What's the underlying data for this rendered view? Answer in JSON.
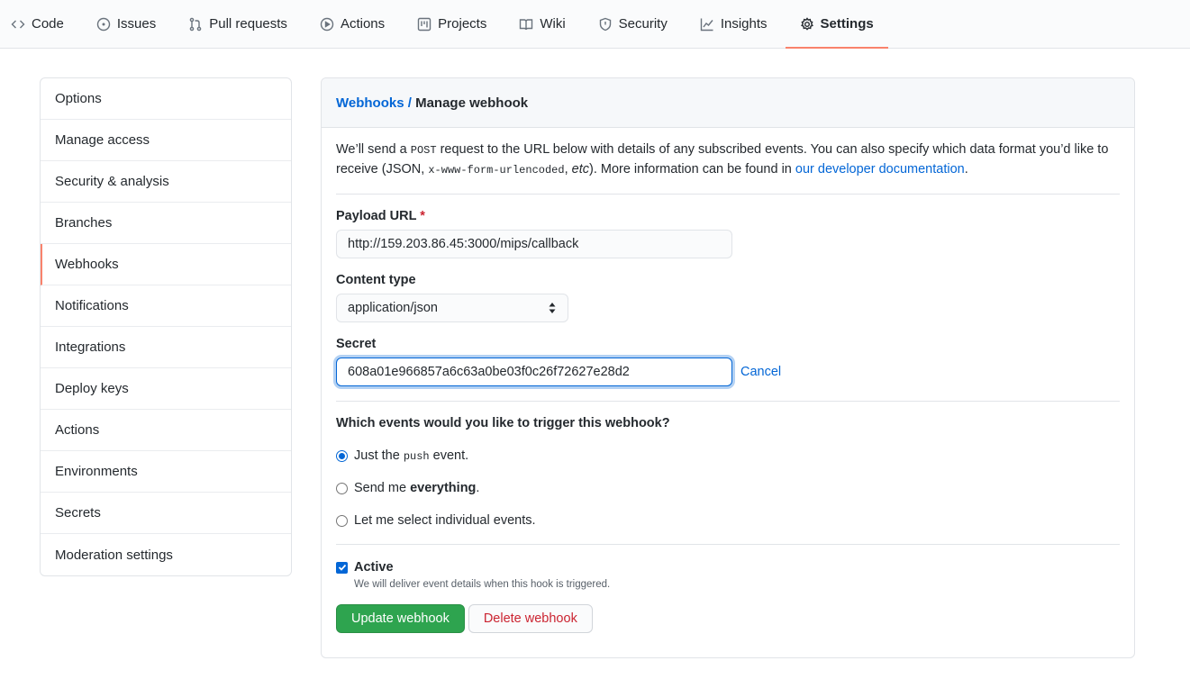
{
  "nav": {
    "tabs": [
      {
        "label": "Code",
        "icon": "code-icon"
      },
      {
        "label": "Issues",
        "icon": "issue-icon"
      },
      {
        "label": "Pull requests",
        "icon": "pull-request-icon"
      },
      {
        "label": "Actions",
        "icon": "play-icon"
      },
      {
        "label": "Projects",
        "icon": "project-icon"
      },
      {
        "label": "Wiki",
        "icon": "book-icon"
      },
      {
        "label": "Security",
        "icon": "shield-icon"
      },
      {
        "label": "Insights",
        "icon": "graph-icon"
      },
      {
        "label": "Settings",
        "icon": "gear-icon",
        "selected": true
      }
    ]
  },
  "sidebar": {
    "items": [
      {
        "label": "Options"
      },
      {
        "label": "Manage access"
      },
      {
        "label": "Security & analysis"
      },
      {
        "label": "Branches"
      },
      {
        "label": "Webhooks",
        "active": true
      },
      {
        "label": "Notifications"
      },
      {
        "label": "Integrations"
      },
      {
        "label": "Deploy keys"
      },
      {
        "label": "Actions"
      },
      {
        "label": "Environments"
      },
      {
        "label": "Secrets"
      },
      {
        "label": "Moderation settings"
      }
    ]
  },
  "header": {
    "breadcrumb_link": "Webhooks",
    "separator": " / ",
    "current": "Manage webhook"
  },
  "intro": {
    "part1": "We’ll send a ",
    "code1": "POST",
    "part2": " request to the URL below with details of any subscribed events. You can also specify which data format you’d like to receive (JSON, ",
    "code2": "x-www-form-urlencoded",
    "part3": ", ",
    "etc": "etc",
    "part4": "). More information can be found in ",
    "link": "our developer documentation",
    "part5": "."
  },
  "form": {
    "payload_label": "Payload URL",
    "required_mark": "*",
    "payload_value": "http://159.203.86.45:3000/mips/callback",
    "content_type_label": "Content type",
    "content_type_value": "application/json",
    "secret_label": "Secret",
    "secret_value": "608a01e966857a6c63a0be03f0c26f72627e28d2",
    "cancel": "Cancel",
    "events_question": "Which events would you like to trigger this webhook?",
    "events": {
      "push_pre": "Just the ",
      "push_code": "push",
      "push_post": " event.",
      "everything_pre": "Send me ",
      "everything_bold": "everything",
      "everything_post": ".",
      "individual": "Let me select individual events."
    },
    "active_label": "Active",
    "active_note": "We will deliver event details when this hook is triggered.",
    "update_button": "Update webhook",
    "delete_button": "Delete webhook"
  },
  "colors": {
    "accent": "#0366d6",
    "selected_underline": "#f9826c",
    "primary_button": "#2ea44f",
    "danger_text": "#cb2431"
  }
}
